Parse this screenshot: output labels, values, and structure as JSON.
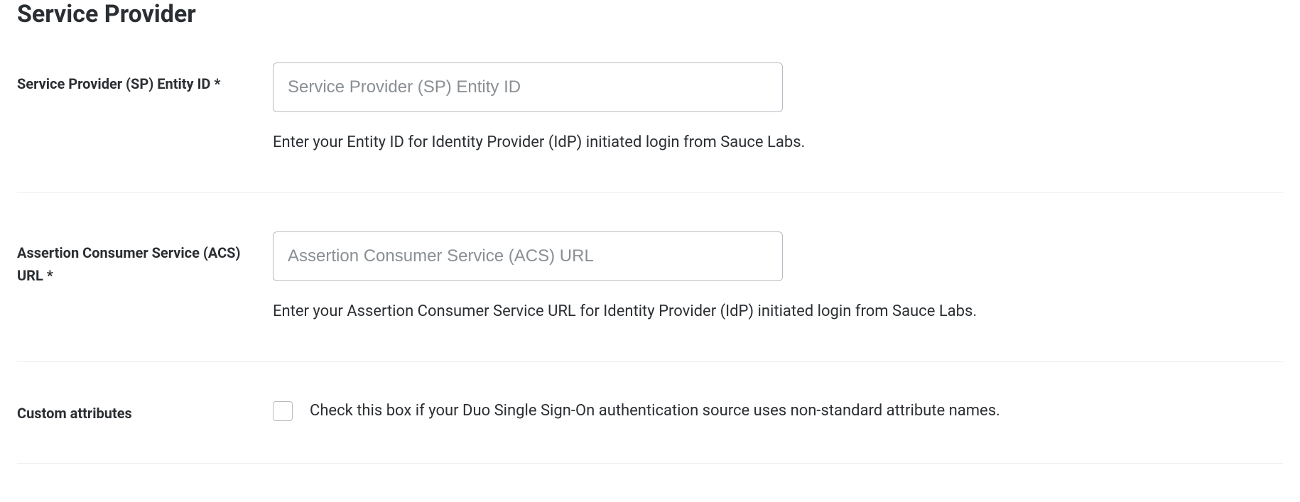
{
  "heading": "Service Provider",
  "fields": {
    "entity_id": {
      "label": "Service Provider (SP) Entity ID *",
      "placeholder": "Service Provider (SP) Entity ID",
      "help": "Enter your Entity ID for Identity Provider (IdP) initiated login from Sauce Labs."
    },
    "acs_url": {
      "label": "Assertion Consumer Service (ACS) URL *",
      "placeholder": "Assertion Consumer Service (ACS) URL",
      "help": "Enter your Assertion Consumer Service URL for Identity Provider (IdP) initiated login from Sauce Labs."
    },
    "custom_attributes": {
      "label": "Custom attributes",
      "checkbox_label": "Check this box if your Duo Single Sign-On authentication source uses non-standard attribute names."
    }
  }
}
